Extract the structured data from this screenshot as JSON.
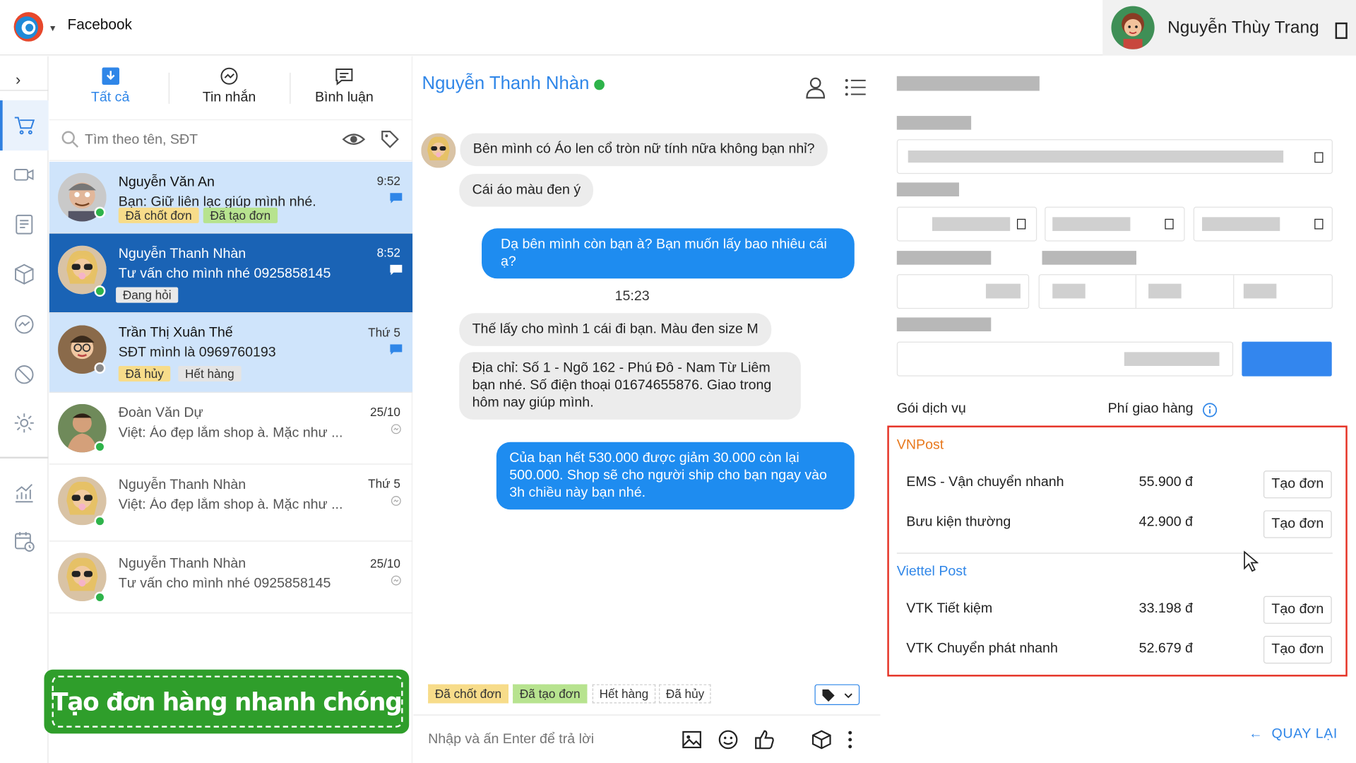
{
  "app": {
    "name": "Facebook"
  },
  "user": {
    "name": "Nguyễn Thùy Trang"
  },
  "tabs": [
    {
      "label": "Tất cả"
    },
    {
      "label": "Tin nhắn"
    },
    {
      "label": "Bình luận"
    }
  ],
  "search": {
    "placeholder": "Tìm theo tên, SĐT"
  },
  "conversations": [
    {
      "name": "Nguyễn Văn An",
      "preview": "Bạn: Giữ liên lạc giúp mình nhé.",
      "time": "9:52",
      "tags": [
        "Đã chốt đơn",
        "Đã tạo đơn"
      ]
    },
    {
      "name": "Nguyễn Thanh Nhàn",
      "preview": "Tư vấn cho mình nhé 0925858145",
      "time": "8:52",
      "tags": [
        "Đang hỏi"
      ]
    },
    {
      "name": "Trần Thị Xuân Thế",
      "preview": "SĐT mình là 0969760193",
      "time": "Thứ 5",
      "tags": [
        "Đã hủy",
        "Hết hàng"
      ]
    },
    {
      "name": "Đoàn Văn Dự",
      "preview": "Việt: Áo đẹp lắm shop à. Mặc như ...",
      "time": "25/10"
    },
    {
      "name": "Nguyễn Thanh Nhàn",
      "preview": "Việt: Áo đẹp lắm shop à. Mặc như ...",
      "time": "Thứ 5"
    },
    {
      "name": "Nguyễn Thanh Nhàn",
      "preview": "Tư vấn cho mình nhé 0925858145",
      "time": "25/10"
    }
  ],
  "promo": {
    "text": "Tạo đơn hàng nhanh chóng"
  },
  "chat": {
    "title": "Nguyễn Thanh Nhàn",
    "messages": [
      "Bên mình có Áo len cổ tròn nữ tính nữa không bạn nhỉ?",
      "Cái áo màu đen ý",
      "Dạ bên mình còn bạn à? Bạn muốn lấy bao nhiêu cái ạ?",
      "Thế lấy cho mình 1 cái đi bạn. Màu đen size M",
      "Địa chỉ: Số 1 - Ngõ 162 - Phú Đô - Nam Từ Liêm bạn nhé. Số điện thoại 01674655876. Giao trong hôm nay giúp mình.",
      "Của bạn hết 530.000 được giảm 30.000 còn lại 500.000. Shop sẽ cho người ship cho bạn ngay vào 3h chiều này bạn nhé."
    ],
    "time_separator": "15:23",
    "tag_bar": [
      "Đã chốt đơn",
      "Đã tạo đơn",
      "Hết hàng",
      "Đã hủy"
    ],
    "reply_placeholder": "Nhập và ấn Enter để trả lời"
  },
  "shipping": {
    "service_label": "Gói dịch vụ",
    "fee_label": "Phí giao hàng",
    "create_label": "Tạo đơn",
    "back_label": "QUAY LẠI",
    "carriers": [
      {
        "name": "VNPost",
        "color": "#e8791e",
        "services": [
          {
            "name": "EMS - Vận chuyển nhanh",
            "price": "55.900 đ"
          },
          {
            "name": "Bưu kiện thường",
            "price": "42.900 đ"
          }
        ]
      },
      {
        "name": "Viettel Post",
        "color": "#2f86e8",
        "services": [
          {
            "name": "VTK Tiết kiệm",
            "price": "33.198 đ"
          },
          {
            "name": "VTK Chuyển phát nhanh",
            "price": "52.679 đ"
          }
        ]
      }
    ]
  },
  "colors": {
    "accent": "#2f86e8",
    "highlight": "#e53124",
    "promo": "#2f9e2b"
  }
}
